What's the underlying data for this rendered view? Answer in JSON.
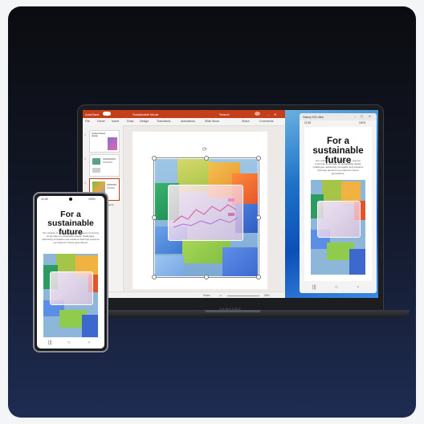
{
  "laptop": {
    "brand": "SAMSUNG",
    "powerpoint": {
      "titlebar": {
        "autosave": "AutoSave",
        "file_name": "Sustainable future",
        "search": "Search"
      },
      "ribbon_tabs": [
        "File",
        "Home",
        "Insert",
        "Draw",
        "Design",
        "Transitions",
        "Animations",
        "Slide Show"
      ],
      "share_label": "Share",
      "comments_label": "Comments",
      "slides": [
        {
          "number": "1",
          "title": "Impact-based design"
        },
        {
          "number": "2",
          "title": ""
        },
        {
          "number": "3",
          "title": "Sustainable and Beyond"
        }
      ],
      "status": {
        "slide_info": "Slide 3 of 3",
        "notes": "Notes",
        "zoom": "58%"
      }
    },
    "phone_mirror": {
      "window_title": "Galaxy S24 Ultra",
      "time": "12:45",
      "battery": "100%",
      "headline": "For a sustainable future",
      "body": "Our mission is to create a cleaner, greener tomorrow as we take on sustainable design challenges, advancing innovation and solutions that help preserve our planet for future generations."
    }
  },
  "phone": {
    "time": "12:45",
    "battery": "100%",
    "headline": "For a sustainable future",
    "body": "Our mission is to create a cleaner, greener tomorrow as we take on sustainable design challenges, advancing innovation and solutions that help preserve our planet for future generations."
  },
  "icons": [
    "close-icon",
    "minimize-icon",
    "maximize-icon",
    "back-icon",
    "home-icon",
    "recents-icon",
    "rotate-icon"
  ],
  "colors": {
    "powerpoint_accent": "#c43e1c",
    "background_top": "#0b0c10",
    "background_bottom": "#1e2c52"
  }
}
